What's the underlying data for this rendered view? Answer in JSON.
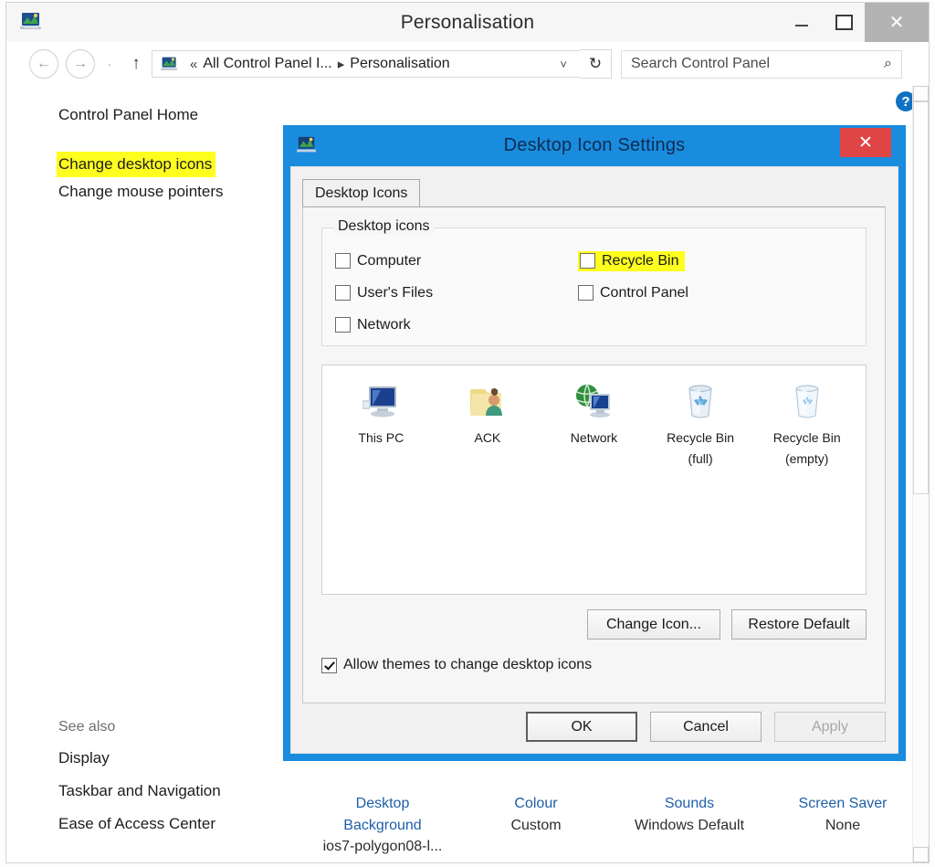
{
  "window": {
    "title": "Personalisation",
    "icon": "personalisation-icon",
    "controls": {
      "minimize": "—",
      "maximize": "□",
      "close": "✕"
    }
  },
  "addressbar": {
    "back": "←",
    "forward": "→",
    "recent_dot": "˅",
    "up": "↑",
    "breadcrumb_prefix": "«",
    "breadcrumb_parent": "All Control Panel I...",
    "breadcrumb_sep": "▸",
    "breadcrumb_current": "Personalisation",
    "breadcrumb_chevron": "˅",
    "refresh": "↻"
  },
  "search": {
    "placeholder": "Search Control Panel",
    "icon": "⌕"
  },
  "help": {
    "label": "?"
  },
  "sidebar": {
    "home": "Control Panel Home",
    "items": [
      {
        "label": "Change desktop icons",
        "highlighted": true
      },
      {
        "label": "Change mouse pointers",
        "highlighted": false
      }
    ],
    "see_also_title": "See also",
    "see_also": [
      {
        "label": "Display"
      },
      {
        "label": "Taskbar and Navigation"
      },
      {
        "label": "Ease of Access Center"
      }
    ]
  },
  "theme_settings": [
    {
      "name": "Desktop\nBackground",
      "value": "ios7-polygon08-l..."
    },
    {
      "name": "Colour",
      "value": "Custom"
    },
    {
      "name": "Sounds",
      "value": "Windows Default"
    },
    {
      "name": "Screen Saver",
      "value": "None"
    }
  ],
  "theme_settings_flat": {
    "desktop_background_name_l1": "Desktop",
    "desktop_background_name_l2": "Background",
    "desktop_background_value": "ios7-polygon08-l...",
    "colour_name": "Colour",
    "colour_value": "Custom",
    "sounds_name": "Sounds",
    "sounds_value": "Windows Default",
    "screensaver_name": "Screen Saver",
    "screensaver_value": "None"
  },
  "dialog": {
    "title": "Desktop Icon Settings",
    "icon": "personalisation-icon",
    "close": "✕",
    "tab": "Desktop Icons",
    "group_legend": "Desktop icons",
    "checkboxes_left": [
      {
        "label": "Computer",
        "checked": false,
        "highlighted": false
      },
      {
        "label": "User's Files",
        "checked": false,
        "highlighted": false
      },
      {
        "label": "Network",
        "checked": false,
        "highlighted": false
      }
    ],
    "checkboxes_right": [
      {
        "label": "Recycle Bin",
        "checked": false,
        "highlighted": true
      },
      {
        "label": "Control Panel",
        "checked": false,
        "highlighted": false
      }
    ],
    "preview_icons": [
      {
        "label": "This PC",
        "label2": "",
        "icon": "computer-icon"
      },
      {
        "label": "ACK",
        "label2": "",
        "icon": "user-folder-icon"
      },
      {
        "label": "Network",
        "label2": "",
        "icon": "network-icon"
      },
      {
        "label": "Recycle Bin",
        "label2": "(full)",
        "icon": "recycle-bin-full-icon"
      },
      {
        "label": "Recycle Bin",
        "label2": "(empty)",
        "icon": "recycle-bin-empty-icon"
      }
    ],
    "change_icon_button": "Change Icon...",
    "restore_default_button": "Restore Default",
    "allow_themes_label": "Allow themes to change desktop icons",
    "allow_themes_checked": true,
    "ok_button": "OK",
    "cancel_button": "Cancel",
    "apply_button": "Apply"
  },
  "colors": {
    "dialog_frame": "#1a8cde",
    "dialog_close": "#e04545",
    "highlight_yellow": "#ffff1f",
    "link_blue": "#1e5fa8",
    "help_blue": "#1172c4"
  }
}
